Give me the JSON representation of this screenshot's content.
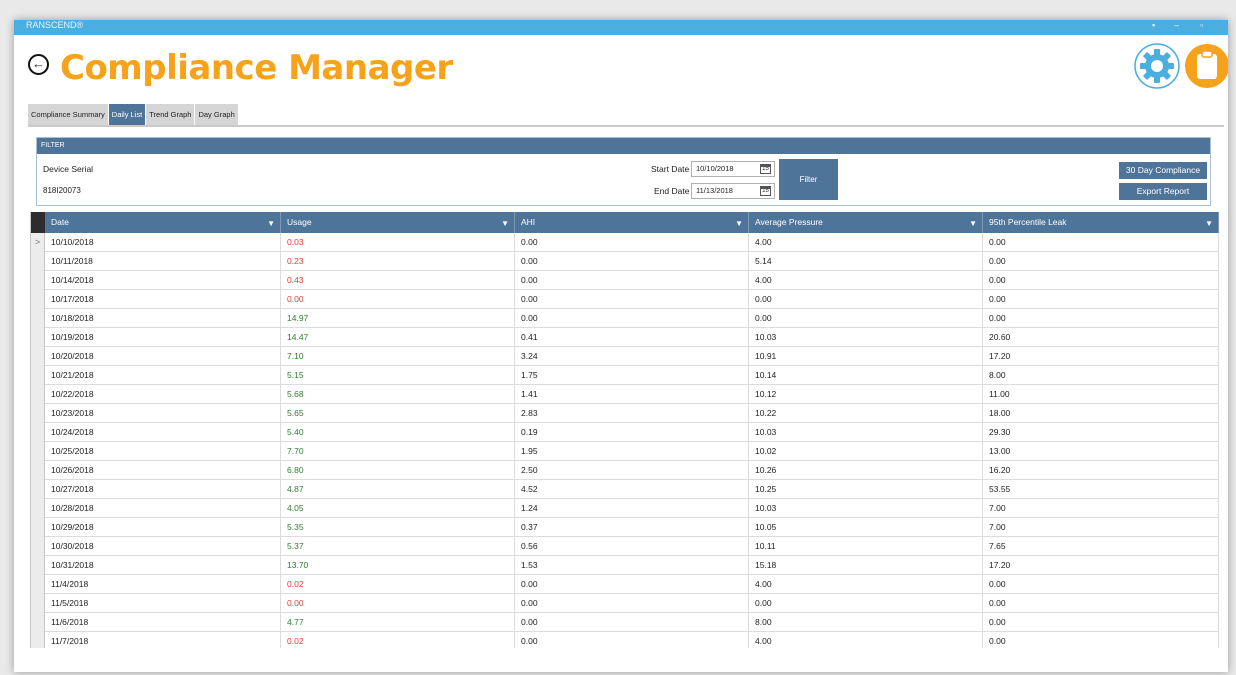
{
  "window": {
    "title_partial": "RANSCEND®"
  },
  "header": {
    "title": "Compliance Manager"
  },
  "tabs": [
    {
      "label": "Compliance Summary",
      "active": false
    },
    {
      "label": "Daily List",
      "active": true
    },
    {
      "label": "Trend Graph",
      "active": false
    },
    {
      "label": "Day Graph",
      "active": false
    }
  ],
  "filter": {
    "header": "FILTER",
    "device_serial_label": "Device Serial",
    "device_serial_value": "818I20073",
    "start_date_label": "Start Date",
    "start_date_value": "10/10/2018",
    "end_date_label": "End Date",
    "end_date_value": "11/13/2018",
    "filter_button": "Filter",
    "compliance_button": "30 Day Compliance",
    "export_button": "Export Report"
  },
  "grid": {
    "columns": [
      "Date",
      "Usage",
      "AHI",
      "Average Pressure",
      "95th Percentile Leak"
    ],
    "rows": [
      [
        "10/10/2018",
        "0.03",
        "0.00",
        "4.00",
        "0.00"
      ],
      [
        "10/11/2018",
        "0.23",
        "0.00",
        "5.14",
        "0.00"
      ],
      [
        "10/14/2018",
        "0.43",
        "0.00",
        "4.00",
        "0.00"
      ],
      [
        "10/17/2018",
        "0.00",
        "0.00",
        "0.00",
        "0.00"
      ],
      [
        "10/18/2018",
        "14.97",
        "0.00",
        "0.00",
        "0.00"
      ],
      [
        "10/19/2018",
        "14.47",
        "0.41",
        "10.03",
        "20.60"
      ],
      [
        "10/20/2018",
        "7.10",
        "3.24",
        "10.91",
        "17.20"
      ],
      [
        "10/21/2018",
        "5.15",
        "1.75",
        "10.14",
        "8.00"
      ],
      [
        "10/22/2018",
        "5.68",
        "1.41",
        "10.12",
        "11.00"
      ],
      [
        "10/23/2018",
        "5.65",
        "2.83",
        "10.22",
        "18.00"
      ],
      [
        "10/24/2018",
        "5.40",
        "0.19",
        "10.03",
        "29.30"
      ],
      [
        "10/25/2018",
        "7.70",
        "1.95",
        "10.02",
        "13.00"
      ],
      [
        "10/26/2018",
        "6.80",
        "2.50",
        "10.26",
        "16.20"
      ],
      [
        "10/27/2018",
        "4.87",
        "4.52",
        "10.25",
        "53.55"
      ],
      [
        "10/28/2018",
        "4.05",
        "1.24",
        "10.03",
        "7.00"
      ],
      [
        "10/29/2018",
        "5.35",
        "0.37",
        "10.05",
        "7.00"
      ],
      [
        "10/30/2018",
        "5.37",
        "0.56",
        "10.11",
        "7.65"
      ],
      [
        "10/31/2018",
        "13.70",
        "1.53",
        "15.18",
        "17.20"
      ],
      [
        "11/4/2018",
        "0.02",
        "0.00",
        "4.00",
        "0.00"
      ],
      [
        "11/5/2018",
        "0.00",
        "0.00",
        "0.00",
        "0.00"
      ],
      [
        "11/6/2018",
        "4.77",
        "0.00",
        "8.00",
        "0.00"
      ],
      [
        "11/7/2018",
        "0.02",
        "0.00",
        "4.00",
        "0.00"
      ]
    ],
    "usage_status": [
      "low",
      "low",
      "low",
      "low",
      "ok",
      "ok",
      "ok",
      "ok",
      "ok",
      "ok",
      "ok",
      "ok",
      "ok",
      "ok",
      "ok",
      "ok",
      "ok",
      "ok",
      "low",
      "low",
      "ok",
      "low"
    ],
    "selected_row_indicator": ">"
  },
  "colors": {
    "title_orange": "#f7a21b",
    "accent_blue": "#4f7499",
    "titlebar_blue": "#4baee0",
    "usage_low": "#e53935",
    "usage_ok": "#2e7d32"
  },
  "icons": {
    "back": "back-arrow-icon",
    "settings": "gear-icon",
    "report": "clipboard-icon",
    "calendar": "calendar-icon",
    "column_filter": "funnel-filter-icon"
  }
}
